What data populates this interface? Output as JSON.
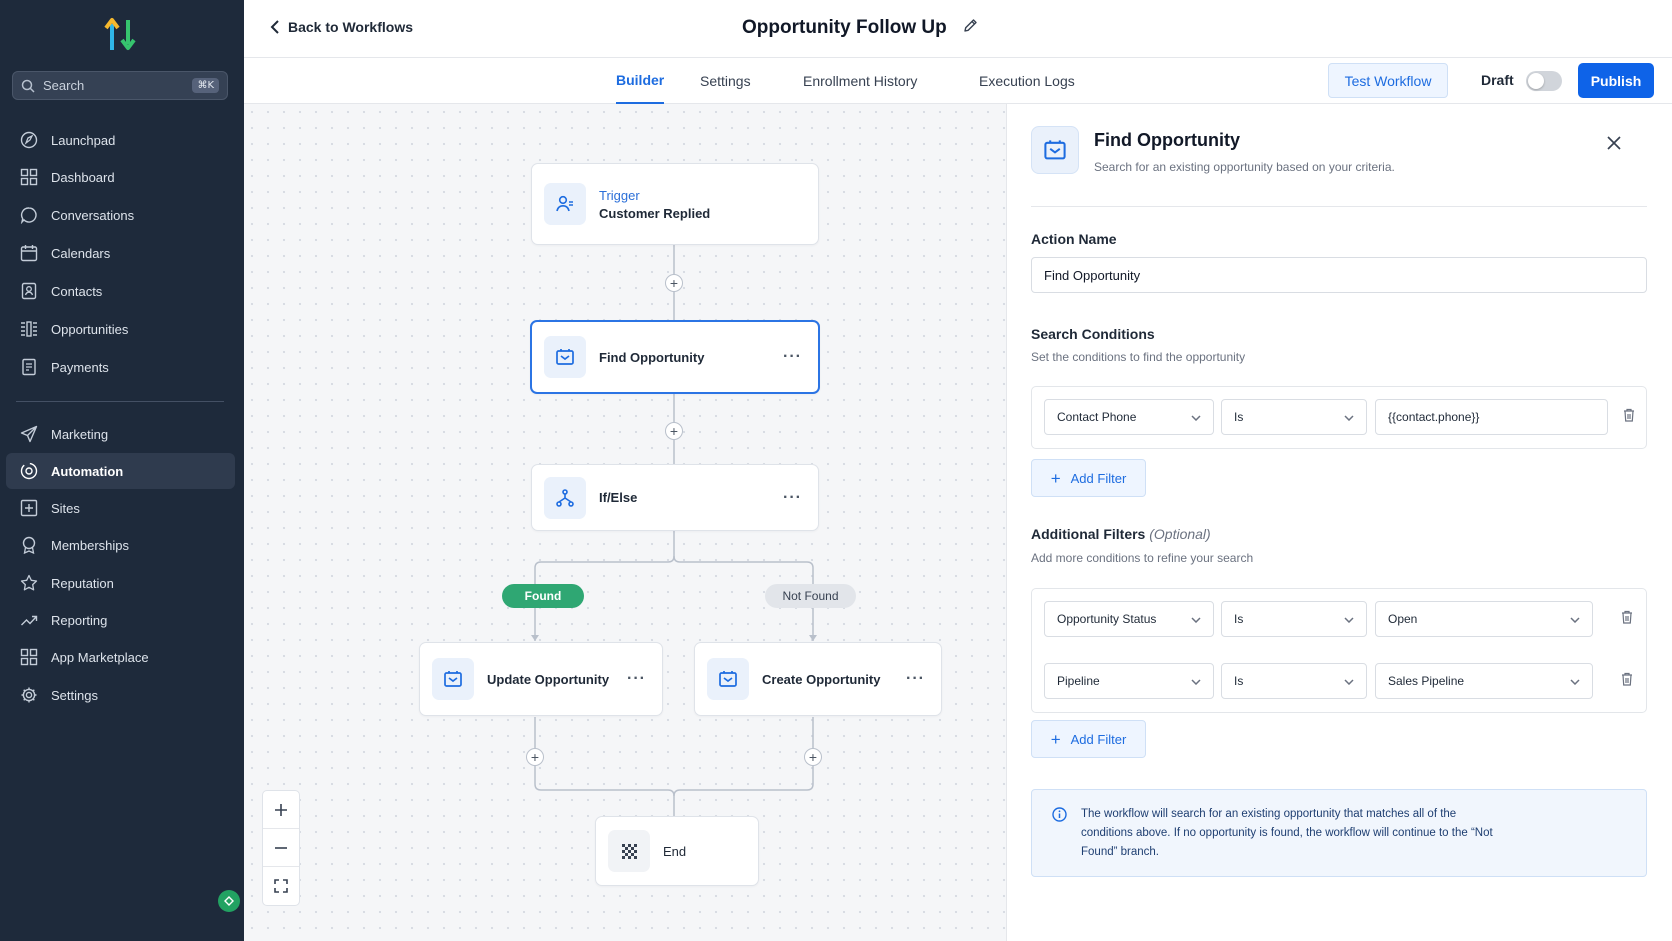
{
  "sidebar": {
    "search_label": "Search",
    "search_shortcut": "⌘K",
    "items": [
      {
        "label": "Launchpad",
        "icon": "rocket-icon"
      },
      {
        "label": "Dashboard",
        "icon": "grid-icon"
      },
      {
        "label": "Conversations",
        "icon": "chat-icon"
      },
      {
        "label": "Calendars",
        "icon": "calendar-icon"
      },
      {
        "label": "Contacts",
        "icon": "contacts-icon"
      },
      {
        "label": "Opportunities",
        "icon": "funnel-icon"
      },
      {
        "label": "Payments",
        "icon": "receipt-icon"
      },
      {
        "label": "Marketing",
        "icon": "send-icon"
      },
      {
        "label": "Automation",
        "icon": "automation-icon",
        "active": true
      },
      {
        "label": "Sites",
        "icon": "sites-icon"
      },
      {
        "label": "Memberships",
        "icon": "badge-icon"
      },
      {
        "label": "Reputation",
        "icon": "star-icon"
      },
      {
        "label": "Reporting",
        "icon": "trend-icon"
      },
      {
        "label": "App Marketplace",
        "icon": "apps-icon"
      },
      {
        "label": "Settings",
        "icon": "gear-icon"
      }
    ]
  },
  "header": {
    "back_label": "Back to Workflows",
    "title": "Opportunity Follow Up"
  },
  "tabs": [
    {
      "label": "Builder",
      "active": true
    },
    {
      "label": "Settings"
    },
    {
      "label": "Enrollment History"
    },
    {
      "label": "Execution Logs"
    }
  ],
  "toolbar": {
    "test_label": "Test Workflow",
    "draft_label": "Draft",
    "draft_on": false,
    "publish_label": "Publish"
  },
  "workflow": {
    "trigger": {
      "subtitle": "Trigger",
      "title": "Customer Replied"
    },
    "find": {
      "title": "Find Opportunity"
    },
    "ifelse": {
      "title": "If/Else"
    },
    "branch_found": "Found",
    "branch_not_found": "Not Found",
    "update": {
      "title": "Update Opportunity"
    },
    "create": {
      "title": "Create Opportunity"
    },
    "end": {
      "title": "End"
    }
  },
  "panel": {
    "title": "Find Opportunity",
    "description": "Search for an existing opportunity based on your criteria.",
    "action_name_label": "Action Name",
    "action_name_value": "Find Opportunity",
    "search_conditions_label": "Search Conditions",
    "search_conditions_help": "Set the conditions to find the opportunity",
    "conditions": [
      {
        "field": "Contact Phone",
        "operator": "Is",
        "value": "{{contact.phone}}"
      }
    ],
    "add_filter_label": "Add Filter",
    "additional_label": "Additional Filters",
    "additional_optional": "(Optional)",
    "additional_help": "Add more conditions to refine your search",
    "filters": [
      {
        "field": "Opportunity Status",
        "operator": "Is",
        "value": "Open"
      },
      {
        "field": "Pipeline",
        "operator": "Is",
        "value": "Sales Pipeline"
      }
    ],
    "info_text": "The workflow will search for an existing opportunity that matches all of the conditions above. If no opportunity is found, the workflow will continue to the “Not Found” branch."
  },
  "colors": {
    "sidebar_bg": "#1e2a3b",
    "accent": "#1d6ce0",
    "publish": "#0e63e8",
    "found": "#2fa773"
  }
}
